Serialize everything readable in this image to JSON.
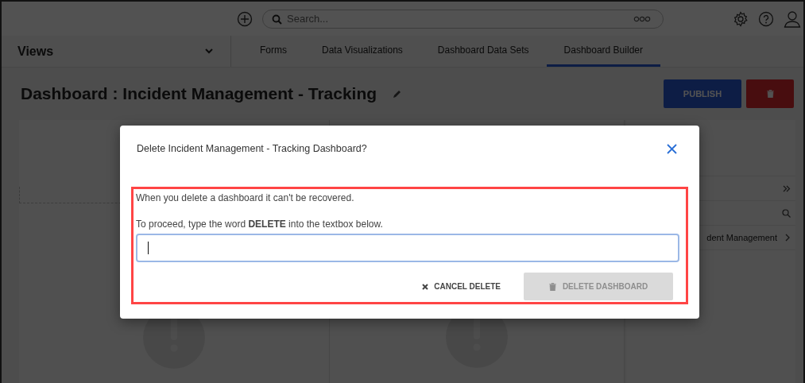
{
  "topbar": {
    "search": {
      "placeholder": "Search..."
    }
  },
  "nav": {
    "views_label": "Views",
    "tabs": [
      {
        "label": "Forms",
        "selected": false
      },
      {
        "label": "Data Visualizations",
        "selected": false
      },
      {
        "label": "Dashboard Data Sets",
        "selected": false
      },
      {
        "label": "Dashboard Builder",
        "selected": true
      }
    ]
  },
  "header": {
    "title": "Dashboard : Incident Management - Tracking",
    "publish_button": "PUBLISH"
  },
  "side_panel": {
    "items": [
      {
        "label": "dent Management"
      }
    ]
  },
  "dialog": {
    "title": "Delete Incident Management - Tracking Dashboard?",
    "message": "When you delete a dashboard it can't be recovered.",
    "instruction": "To proceed, type the word **DELETE** into the textbox below.",
    "cancel_button": {
      "label": "CANCEL DELETE",
      "disabled": false
    },
    "delete_button": {
      "label": "DELETE DASHBOARD",
      "disabled": true
    }
  }
}
